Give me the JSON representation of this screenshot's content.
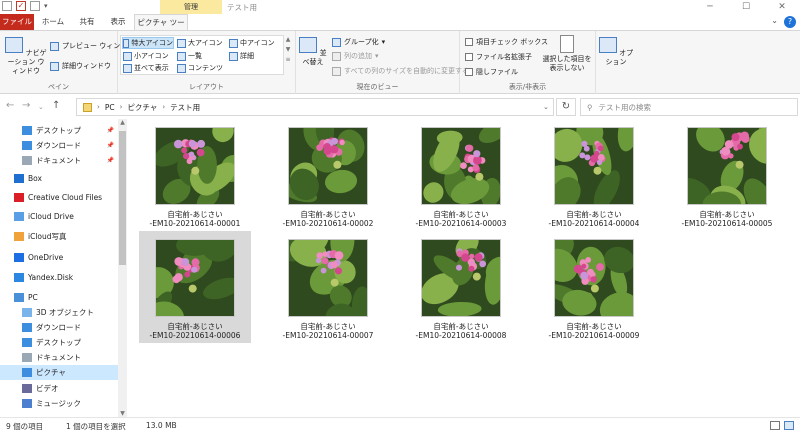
{
  "window": {
    "title": "テスト用",
    "context_tab_group": "管理"
  },
  "tabs": {
    "file": "ファイル",
    "home": "ホーム",
    "share": "共有",
    "view": "表示",
    "picture_tools": "ピクチャ ツール"
  },
  "ribbon": {
    "pane": {
      "label": "ペイン",
      "nav_pane": "ナビゲーション ウィンドウ",
      "preview": "プレビュー ウィンドウ",
      "details": "詳細ウィンドウ"
    },
    "layout": {
      "label": "レイアウト",
      "items": [
        "特大アイコン",
        "大アイコン",
        "中アイコン",
        "小アイコン",
        "一覧",
        "詳細",
        "並べて表示",
        "コンテンツ"
      ]
    },
    "current_view": {
      "label": "現在のビュー",
      "sort": "並べ替え",
      "group": "グループ化",
      "add_column": "列の追加",
      "fit_columns": "すべての列のサイズを自動的に変更する"
    },
    "show_hide": {
      "label": "表示/非表示",
      "item_checkboxes": "項目チェック ボックス",
      "file_ext": "ファイル名拡張子",
      "hidden_files": "隠しファイル",
      "hide_selected": "選択した項目を表示しない"
    },
    "options": "オプション"
  },
  "address": {
    "crumbs": [
      "PC",
      "ピクチャ",
      "テスト用"
    ],
    "search_placeholder": "テスト用の検索"
  },
  "nav": {
    "items": [
      {
        "label": "デスクトップ",
        "icon": "desktop-icon",
        "pinned": true
      },
      {
        "label": "ダウンロード",
        "icon": "download-icon",
        "pinned": true
      },
      {
        "label": "ドキュメント",
        "icon": "document-icon",
        "pinned": true
      },
      {
        "label": "Box",
        "icon": "box-icon"
      },
      {
        "label": "Creative Cloud Files",
        "icon": "creative-cloud-icon"
      },
      {
        "label": "iCloud Drive",
        "icon": "icloud-icon"
      },
      {
        "label": "iCloud写真",
        "icon": "icloud-photos-icon"
      },
      {
        "label": "OneDrive",
        "icon": "onedrive-icon"
      },
      {
        "label": "Yandex.Disk",
        "icon": "yandex-disk-icon"
      },
      {
        "label": "PC",
        "icon": "pc-icon"
      },
      {
        "label": "3D オブジェクト",
        "icon": "3d-objects-icon"
      },
      {
        "label": "ダウンロード",
        "icon": "download-icon"
      },
      {
        "label": "デスクトップ",
        "icon": "desktop-icon"
      },
      {
        "label": "ドキュメント",
        "icon": "document-icon"
      },
      {
        "label": "ピクチャ",
        "icon": "pictures-icon",
        "selected": true
      },
      {
        "label": "ビデオ",
        "icon": "video-icon"
      },
      {
        "label": "ミュージック",
        "icon": "music-icon"
      }
    ]
  },
  "files": [
    {
      "line1": "自宅前-あじさい",
      "line2": "-EM10-20210614-00001"
    },
    {
      "line1": "自宅前-あじさい",
      "line2": "-EM10-20210614-00002"
    },
    {
      "line1": "自宅前-あじさい",
      "line2": "-EM10-20210614-00003"
    },
    {
      "line1": "自宅前-あじさい",
      "line2": "-EM10-20210614-00004"
    },
    {
      "line1": "自宅前-あじさい",
      "line2": "-EM10-20210614-00005"
    },
    {
      "line1": "自宅前-あじさい",
      "line2": "-EM10-20210614-00006",
      "selected": true
    },
    {
      "line1": "自宅前-あじさい",
      "line2": "-EM10-20210614-00007"
    },
    {
      "line1": "自宅前-あじさい",
      "line2": "-EM10-20210614-00008"
    },
    {
      "line1": "自宅前-あじさい",
      "line2": "-EM10-20210614-00009"
    }
  ],
  "status": {
    "count": "9 個の項目",
    "selected": "1 個の項目を選択",
    "size": "13.0 MB"
  },
  "colors": {
    "accent": "#1e73d8",
    "file_tab": "#c42b1c",
    "selection": "#cce8ff",
    "context_tab": "#fbe9a0"
  }
}
